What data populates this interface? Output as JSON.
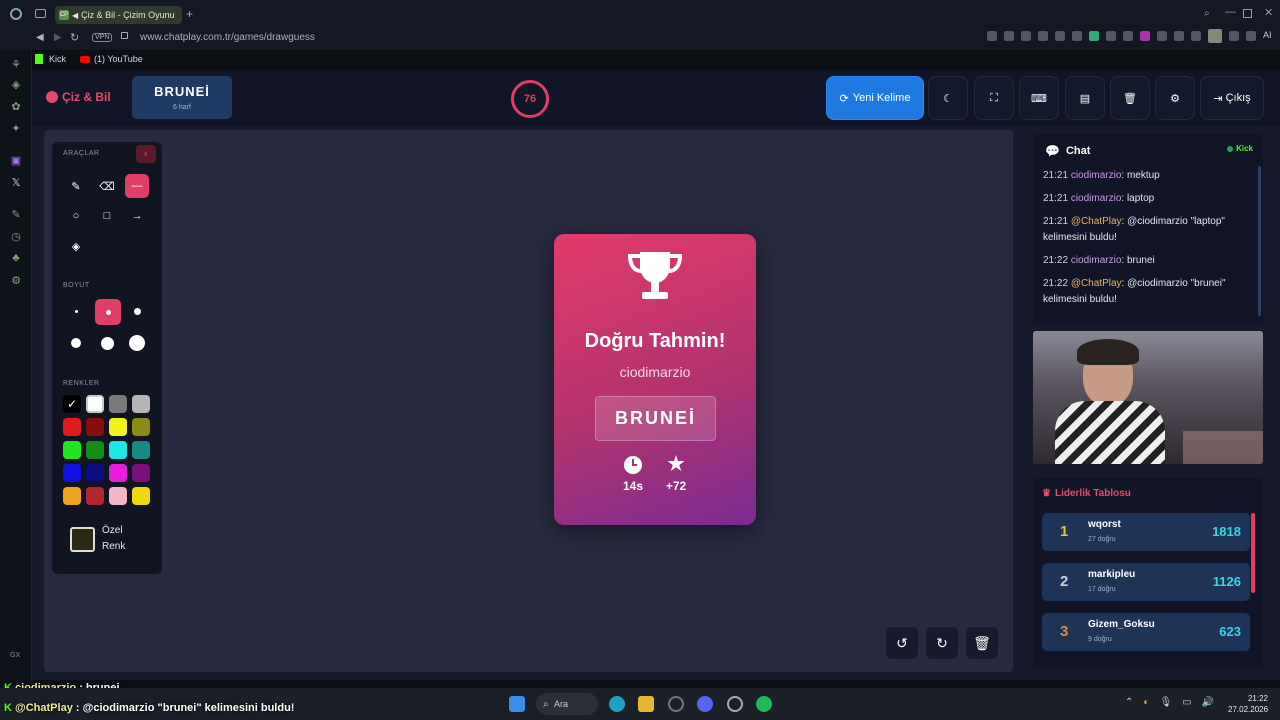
{
  "browser": {
    "tab_title": "Çiz & Bil - Çizim Oyunu",
    "tab_favicon": "CP",
    "address": "www.chatplay.com.tr/games/drawguess",
    "vpn": "VPN",
    "bookmarks": [
      {
        "label": "Kick"
      },
      {
        "label": "(1) YouTube"
      }
    ],
    "ai_label": "AI"
  },
  "header": {
    "logo_text": "Çiz & Bil",
    "word": "BRUNEİ",
    "word_len": "6 harf",
    "timer": "76",
    "new_word": "Yeni Kelime",
    "exit": "Çıkış"
  },
  "tools": {
    "title": "ARAÇLAR",
    "size_title": "BOYUT",
    "colors_title": "RENKLER",
    "custom_color_1": "Özel",
    "custom_color_2": "Renk",
    "colors": [
      "#000000",
      "#ffffff",
      "#7a7a7a",
      "#b5b5b5",
      "#e01b1b",
      "#8a0d0d",
      "#f2f21a",
      "#8a8a14",
      "#22e61f",
      "#188a16",
      "#1ce6e6",
      "#178a85",
      "#1010e0",
      "#0b0b80",
      "#e61ee0",
      "#7a107a",
      "#f0a21a",
      "#b3262e",
      "#f2b6c6",
      "#f0d80e"
    ]
  },
  "modal": {
    "title": "Doğru Tahmin!",
    "user": "ciodimarzio",
    "answer": "BRUNEİ",
    "time": "14s",
    "points": "+72"
  },
  "chat": {
    "title": "Chat",
    "platform": "Kick",
    "messages": [
      {
        "time": "21:21",
        "user": "ciodimarzio",
        "text": ": mektup"
      },
      {
        "time": "21:21",
        "user": "ciodimarzio",
        "text": ": laptop"
      },
      {
        "time": "21:21",
        "user": "@ChatPlay",
        "text": ": @ciodimarzio \"laptop\" kelimesini buldu!"
      },
      {
        "time": "21:22",
        "user": "ciodimarzio",
        "text": ": brunei"
      },
      {
        "time": "21:22",
        "user": "@ChatPlay",
        "text": ": @ciodimarzio \"brunei\" kelimesini buldu!"
      }
    ]
  },
  "leaderboard": {
    "title": "Liderlik Tablosu",
    "rows": [
      {
        "rank": "1",
        "name": "wqorst",
        "count": "27 doğru",
        "score": "1818",
        "color": "#f0c419"
      },
      {
        "rank": "2",
        "name": "markipleu",
        "count": "17 doğru",
        "score": "1126",
        "color": "#c9d2de"
      },
      {
        "rank": "3",
        "name": "Gizem_Goksu",
        "count": "9 doğru",
        "score": "623",
        "color": "#e08a3a"
      }
    ]
  },
  "overlay": {
    "line1_user": "ciodimarzio",
    "line1_text": " : brunei",
    "line2_user": "@ChatPlay",
    "line2_text": " : @ciodimarzio \"brunei\" kelimesini buldu!"
  },
  "taskbar": {
    "search": "Ara",
    "time": "21:22",
    "date": "27.02.2026",
    "gx": "GX"
  }
}
